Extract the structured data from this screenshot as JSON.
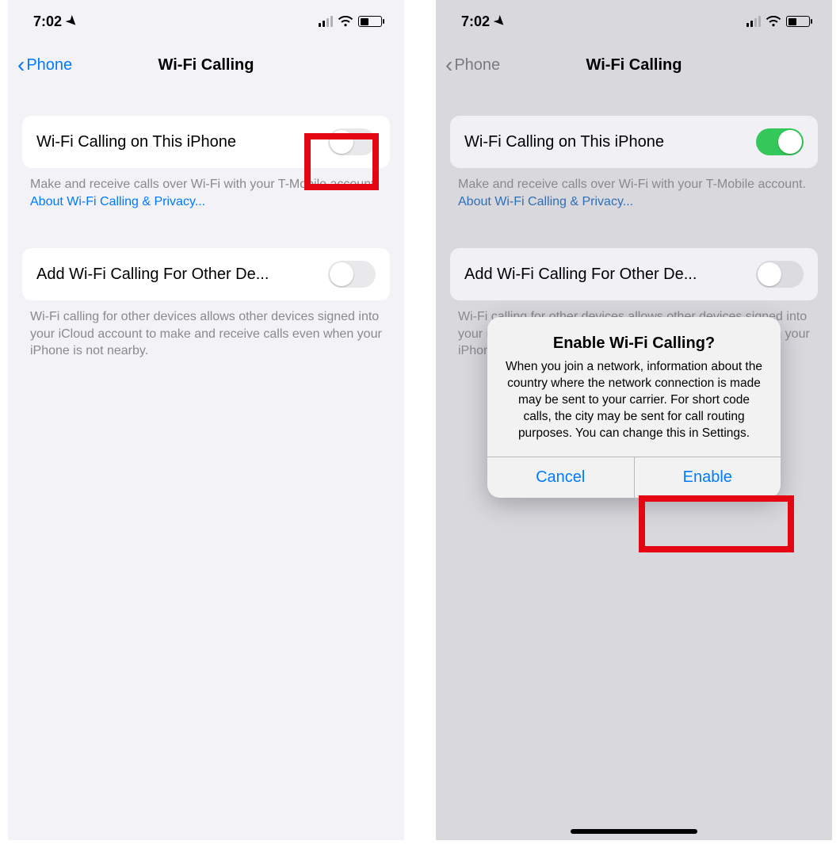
{
  "status": {
    "time": "7:02"
  },
  "nav": {
    "back_label": "Phone",
    "title": "Wi-Fi Calling"
  },
  "group1": {
    "label": "Wi-Fi Calling on This iPhone",
    "footer_text": "Make and receive calls over Wi-Fi with your T-Mobile account. ",
    "footer_link": "About Wi-Fi Calling & Privacy..."
  },
  "group2": {
    "label": "Add Wi-Fi Calling For Other De...",
    "footer_text_full": "Wi-Fi calling for other devices allows other devices signed into your iCloud account to make and receive calls even when your iPhone is not nearby.",
    "footer_text_clipped": "Wi-Fi calling for other devices allows other devices signed into your iCloud account to make and receive calls even when your iPhone is not nearby."
  },
  "dialog": {
    "title": "Enable Wi-Fi Calling?",
    "message": "When you join a network, information about the country where the network connection is made may be sent to your carrier. For short code calls, the city may be sent for call routing purposes. You can change this in Settings.",
    "cancel": "Cancel",
    "confirm": "Enable"
  }
}
